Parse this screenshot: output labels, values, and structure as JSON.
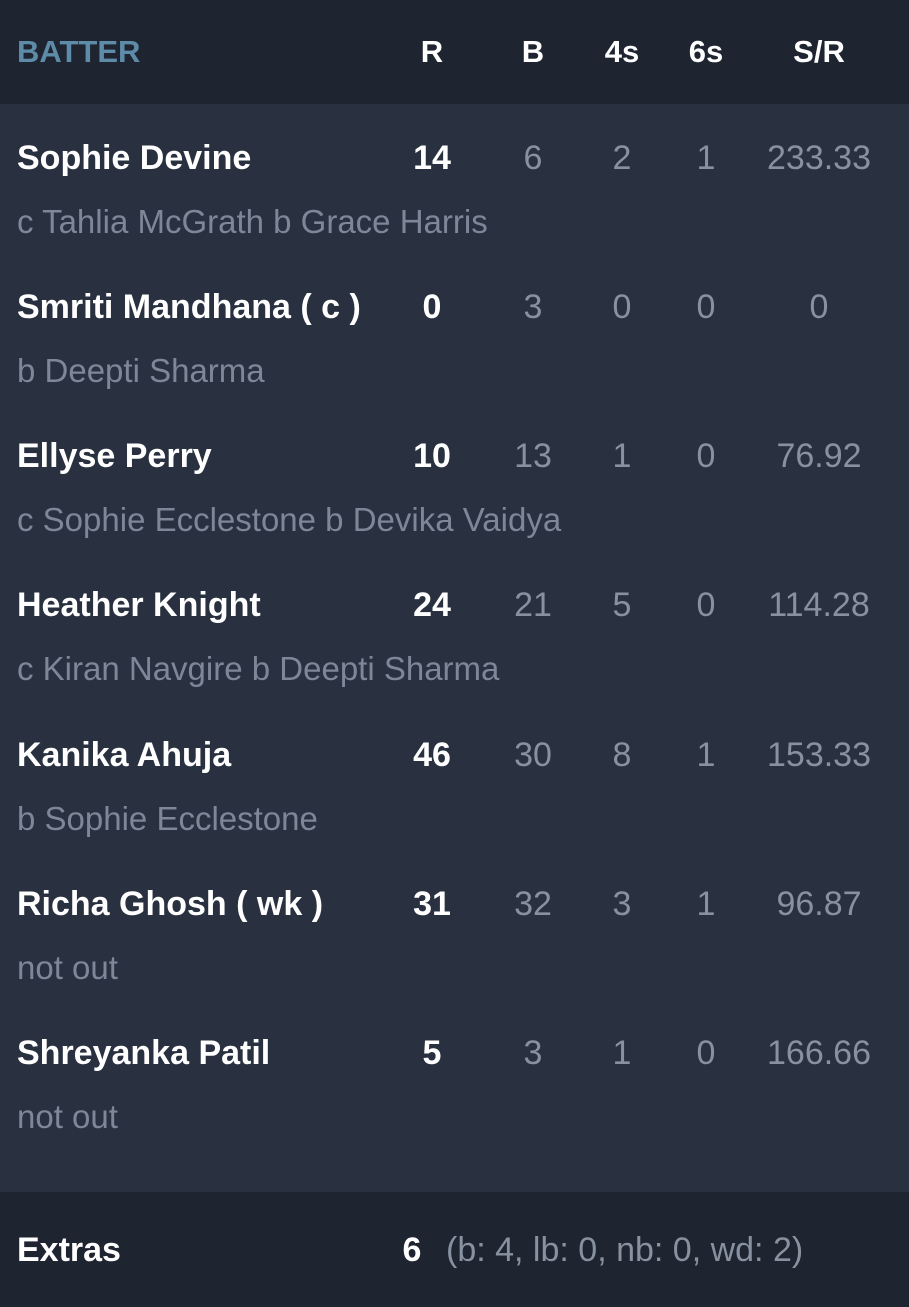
{
  "header": {
    "batter": "BATTER",
    "runs": "R",
    "balls": "B",
    "fours": "4s",
    "sixes": "6s",
    "strike_rate": "S/R"
  },
  "batters": [
    {
      "name": "Sophie Devine",
      "dismissal": "c Tahlia McGrath b Grace Harris",
      "runs": "14",
      "balls": "6",
      "fours": "2",
      "sixes": "1",
      "sr": "233.33"
    },
    {
      "name": "Smriti Mandhana ( c )",
      "dismissal": "b Deepti Sharma",
      "runs": "0",
      "balls": "3",
      "fours": "0",
      "sixes": "0",
      "sr": "0"
    },
    {
      "name": "Ellyse Perry",
      "dismissal": "c Sophie Ecclestone b Devika Vaidya",
      "runs": "10",
      "balls": "13",
      "fours": "1",
      "sixes": "0",
      "sr": "76.92"
    },
    {
      "name": "Heather Knight",
      "dismissal": "c Kiran Navgire b Deepti Sharma",
      "runs": "24",
      "balls": "21",
      "fours": "5",
      "sixes": "0",
      "sr": "114.28"
    },
    {
      "name": "Kanika Ahuja",
      "dismissal": "b Sophie Ecclestone",
      "runs": "46",
      "balls": "30",
      "fours": "8",
      "sixes": "1",
      "sr": "153.33"
    },
    {
      "name": "Richa Ghosh ( wk )",
      "dismissal": "not out",
      "runs": "31",
      "balls": "32",
      "fours": "3",
      "sixes": "1",
      "sr": "96.87"
    },
    {
      "name": "Shreyanka Patil",
      "dismissal": "not out",
      "runs": "5",
      "balls": "3",
      "fours": "1",
      "sixes": "0",
      "sr": "166.66"
    }
  ],
  "extras": {
    "label": "Extras",
    "total": "6",
    "detail": "(b: 4, lb: 0, nb: 0, wd: 2)"
  },
  "colors": {
    "header_bg": "#1e2531",
    "body_bg": "#293140",
    "accent": "#5e8ba8",
    "text_primary": "#ffffff",
    "text_secondary": "#8891a0"
  }
}
